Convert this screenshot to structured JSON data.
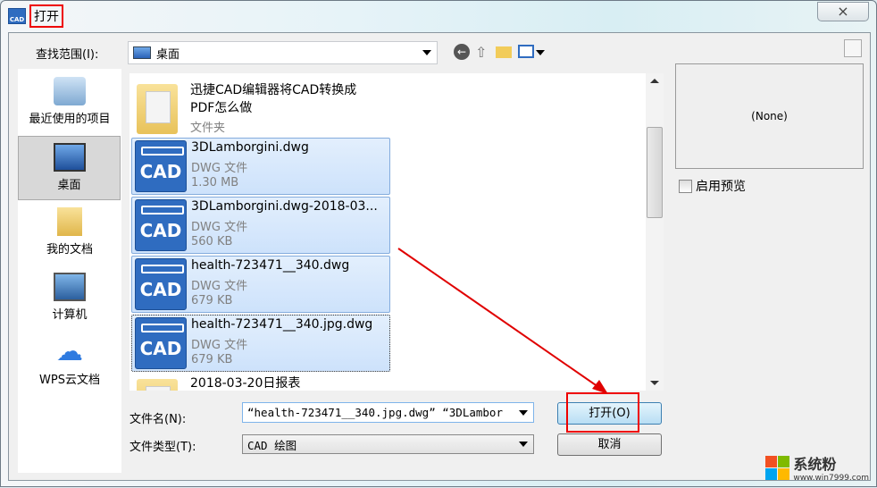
{
  "window": {
    "title": "打开",
    "close_icon": "×"
  },
  "lookin": {
    "label": "查找范围(I):",
    "value": "桌面"
  },
  "sidebar": {
    "items": [
      {
        "label": "最近使用的项目",
        "icon": "recent-icon"
      },
      {
        "label": "桌面",
        "icon": "desktop-icon",
        "selected": true
      },
      {
        "label": "我的文档",
        "icon": "documents-icon"
      },
      {
        "label": "计算机",
        "icon": "computer-icon"
      },
      {
        "label": "WPS云文档",
        "icon": "cloud-icon"
      }
    ]
  },
  "files": [
    {
      "name1": "迅捷CAD编辑器将CAD转换成",
      "name2": "PDF怎么做",
      "type": "文件夹",
      "kind": "folder"
    },
    {
      "name1": "3DLamborgini.dwg",
      "type": "DWG 文件",
      "size": "1.30 MB",
      "kind": "cad",
      "selected": true
    },
    {
      "name1": "3DLamborgini.dwg-2018-03...",
      "type": "DWG 文件",
      "size": "560 KB",
      "kind": "cad",
      "selected": true
    },
    {
      "name1": "health-723471__340.dwg",
      "type": "DWG 文件",
      "size": "679 KB",
      "kind": "cad",
      "selected": true
    },
    {
      "name1": "health-723471__340.jpg.dwg",
      "type": "DWG 文件",
      "size": "679 KB",
      "kind": "cad",
      "selected": true
    },
    {
      "name1": "2018-03-20日报表",
      "kind": "folder"
    }
  ],
  "preview": {
    "text": "(None)",
    "checkbox_label": "启用预览",
    "checked": false
  },
  "filename": {
    "label": "文件名(N):",
    "value": "“health-723471__340.jpg.dwg” “3DLambor"
  },
  "filetype": {
    "label": "文件类型(T):",
    "value": "CAD 绘图"
  },
  "buttons": {
    "open": "打开(O)",
    "cancel": "取消"
  },
  "watermark": {
    "text": "系统粉",
    "url": "www.win7999.com"
  },
  "colors": {
    "annotation": "#e00000",
    "selection": "#cde2fb",
    "cad_icon": "#2f6cc0"
  }
}
